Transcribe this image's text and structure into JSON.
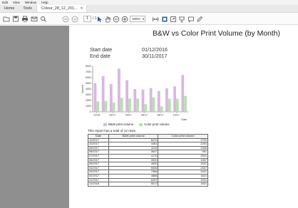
{
  "menu": {
    "items": [
      "Edit",
      "View",
      "Window",
      "Help"
    ]
  },
  "tabs": [
    {
      "label": "Home"
    },
    {
      "label": "Tools"
    },
    {
      "label": "Colour_28_12_201..."
    }
  ],
  "toolbar": {
    "page_current": "1",
    "page_total": "/ 1",
    "zoom": "105%"
  },
  "report": {
    "title": "B&W vs Color Print Volume (by Month)",
    "start_label": "Start date",
    "start_value": "01/12/2016",
    "end_label": "End date",
    "end_value": "30/11/2017",
    "note": "This report has a total of 12 rows."
  },
  "colors": {
    "bw": "#d7b8df",
    "color": "#b8e0b0"
  },
  "chart_data": {
    "type": "bar",
    "ylabel": "Volume",
    "xlabel": "Date",
    "ylim": [
      0,
      8000
    ],
    "yticks": [
      "8000",
      "7000",
      "6000",
      "5000",
      "4000",
      "3000",
      "2000",
      "1000",
      "0"
    ],
    "categories": [
      "12/16",
      "01/17",
      "02/17",
      "03/17",
      "04/17",
      "05/17",
      "06/17",
      "07/17",
      "08/17",
      "09/17",
      "10/17",
      "11/17"
    ],
    "tick_labels": [
      "12/16",
      "02/17",
      "04/17",
      "06/17",
      "08/17",
      "10/17"
    ],
    "series": [
      {
        "name": "B&W print volume",
        "values": [
          5017,
          6257,
          4868,
          7586,
          5536,
          4000,
          3920,
          4170,
          3647,
          4119,
          4461,
          6470
        ]
      },
      {
        "name": "Color print volume",
        "values": [
          1831,
          1910,
          1610,
          2447,
          2337,
          2337,
          1357,
          2541,
          951,
          2306,
          2294,
          2792
        ]
      }
    ]
  },
  "table": {
    "headers": [
      "Date",
      "B&W print volume",
      "Color print volume"
    ],
    "rows": [
      [
        "11/2017",
        "6470",
        "2792"
      ],
      [
        "10/2017",
        "4461",
        "2294"
      ],
      [
        "09/2017",
        "4119",
        "2306"
      ],
      [
        "08/2017",
        "3647",
        "951"
      ],
      [
        "07/2017",
        "4170",
        "2541"
      ],
      [
        "06/2017",
        "3920",
        "1357"
      ],
      [
        "05/2017",
        "4000",
        "2337"
      ],
      [
        "04/2017",
        "5536",
        "2337"
      ],
      [
        "03/2017",
        "7586",
        "2447"
      ],
      [
        "02/2017",
        "4868",
        "1610"
      ],
      [
        "01/2017",
        "6257",
        "1910"
      ],
      [
        "12/2016",
        "5017",
        "1831"
      ]
    ]
  }
}
